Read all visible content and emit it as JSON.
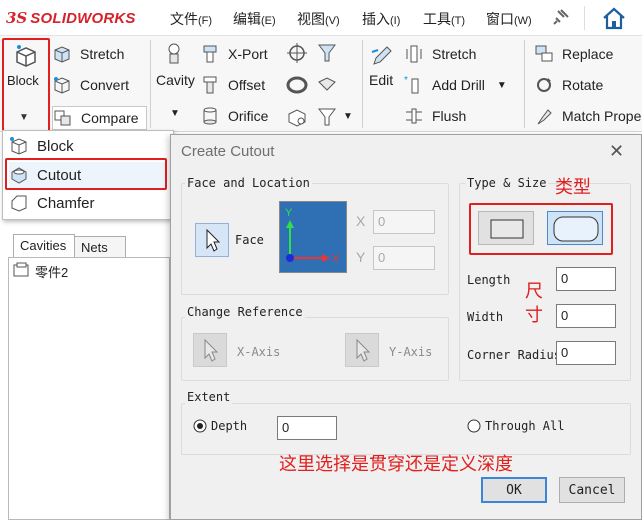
{
  "app": {
    "logo_ds": "3S",
    "logo_brand": "SOLIDWORKS"
  },
  "menu": [
    {
      "label": "文件",
      "key": "(F)"
    },
    {
      "label": "编辑",
      "key": "(E)"
    },
    {
      "label": "视图",
      "key": "(V)"
    },
    {
      "label": "插入",
      "key": "(I)"
    },
    {
      "label": "工具",
      "key": "(T)"
    },
    {
      "label": "窗口",
      "key": "(W)"
    }
  ],
  "ribbon": {
    "block": "Block",
    "stretch1": "Stretch",
    "convert": "Convert",
    "compare": "Compare",
    "cavity": "Cavity",
    "xport": "X-Port",
    "offset": "Offset",
    "orifice": "Orifice",
    "edit": "Edit",
    "stretch2": "Stretch",
    "add_drill": "Add Drill",
    "flush": "Flush",
    "replace": "Replace",
    "rotate": "Rotate",
    "match": "Match Prope"
  },
  "dropdown": {
    "block": "Block",
    "cutout": "Cutout",
    "chamfer": "Chamfer"
  },
  "panel": {
    "tab_cavities": "Cavities",
    "tab_nets": "Nets",
    "tree_item": "零件2"
  },
  "dialog": {
    "title": "Create Cutout",
    "face_location": "Face and Location",
    "face": "Face",
    "x_label": "X",
    "x_value": "0",
    "y_label": "Y",
    "y_value": "0",
    "type_size": "Type & Size",
    "type_note": "类型",
    "length_label": "Length",
    "length_value": "0",
    "width_label": "Width",
    "width_value": "0",
    "corner_label": "Corner Radius",
    "corner_value": "0",
    "size_note": "尺\n寸",
    "change_ref": "Change Reference",
    "x_axis": "X-Axis",
    "y_axis": "Y-Axis",
    "extent": "Extent",
    "depth_label": "Depth",
    "depth_value": "0",
    "through_all": "Through All",
    "extent_note": "这里选择是贯穿还是定义深度",
    "ok": "OK",
    "cancel": "Cancel"
  },
  "colors": {
    "accent_red": "#e0201f",
    "brand_red": "#d6222b",
    "face_preview": "#2f6fb3"
  }
}
